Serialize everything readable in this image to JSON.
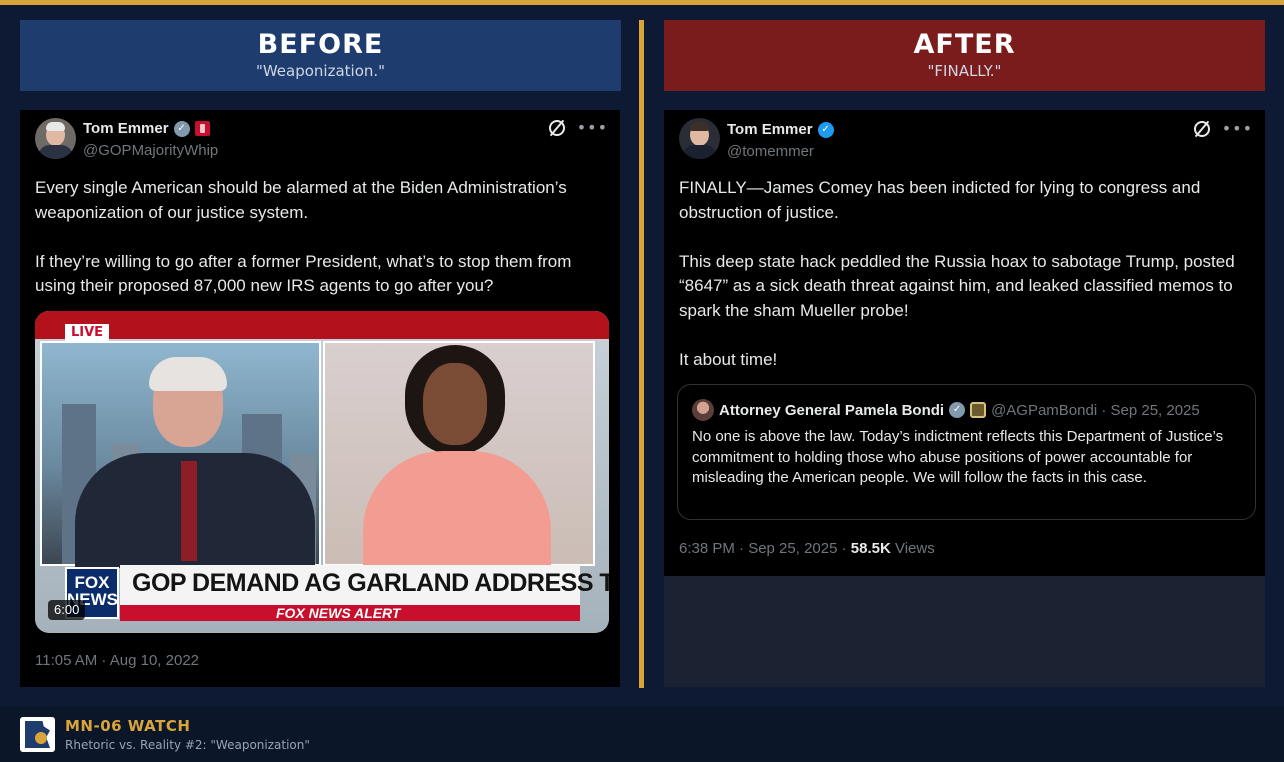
{
  "colors": {
    "background": "#0e1a33",
    "accent_gold": "#d9a53a",
    "before_banner": "#1f3c6e",
    "after_banner": "#7a1c1c",
    "tweet_bg": "#000000",
    "verified_blue": "#1d9bf0"
  },
  "before": {
    "title": "BEFORE",
    "subtitle": "\"Weaponization.\"",
    "tweet": {
      "name": "Tom Emmer",
      "handle": "@GOPMajorityWhip",
      "verified": "grey-check",
      "paragraphs": [
        "Every single American should be alarmed at the Biden Administration’s weaponization of our justice system.",
        "If they’re willing to go after a former President, what’s to stop them from using their proposed 87,000 new IRS agents to go after you?"
      ],
      "video": {
        "live_label": "LIVE",
        "headline": "GOP DEMAND AG GARLAND ADDRESS TRUMP RAID",
        "alert": "FOX NEWS ALERT",
        "network": "FOX NEWS",
        "duration": "6:00"
      },
      "timestamp": "11:05 AM · Aug 10, 2022"
    }
  },
  "after": {
    "title": "AFTER",
    "subtitle": "\"FINALLY.\"",
    "tweet": {
      "name": "Tom Emmer",
      "handle": "@tomemmer",
      "verified": "blue-check",
      "paragraphs": [
        "FINALLY—James Comey has been indicted for lying to congress and obstruction of justice.",
        "This deep state hack peddled the Russia hoax to sabotage Trump, posted “8647” as a sick death threat against him, and  leaked classified memos to spark the sham Mueller probe!",
        "It about time!"
      ],
      "quote": {
        "name": "Attorney General Pamela Bondi",
        "handle_date": "@AGPamBondi · Sep 25, 2025",
        "text": "No one is above the law. Today’s indictment reflects this Department of Justice’s commitment to holding those who abuse positions of power accountable for misleading the American people. We will follow the facts in this case."
      },
      "time": "6:38 PM · Sep 25, 2025 · ",
      "views_count": "58.5K",
      "views_label": " Views"
    }
  },
  "footer": {
    "brand": "MN-06 WATCH",
    "tagline": "Rhetoric vs. Reality #2: \"Weaponization\""
  }
}
